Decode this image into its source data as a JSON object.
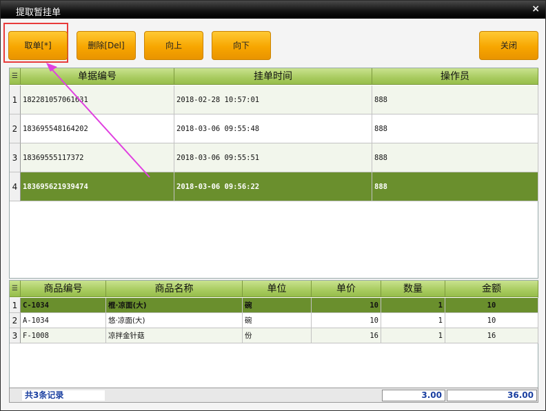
{
  "window": {
    "title": "提取暂挂单",
    "close_glyph": "×"
  },
  "toolbar": {
    "take_label": "取单[*]",
    "delete_label": "删除[Del]",
    "up_label": "向上",
    "down_label": "向下",
    "close_label": "关闭"
  },
  "orders": {
    "columns": [
      "单据编号",
      "挂单时间",
      "操作员"
    ],
    "rows": [
      {
        "idx": "1",
        "id": "182281057061631",
        "time": "2018-02-28 10:57:01",
        "operator": "888"
      },
      {
        "idx": "2",
        "id": "183695548164202",
        "time": "2018-03-06 09:55:48",
        "operator": "888"
      },
      {
        "idx": "3",
        "id": "18369555117372",
        "time": "2018-03-06 09:55:51",
        "operator": "888"
      },
      {
        "idx": "4",
        "id": "183695621939474",
        "time": "2018-03-06 09:56:22",
        "operator": "888"
      }
    ],
    "selected_row": 4
  },
  "items": {
    "columns": [
      "商品编号",
      "商品名称",
      "单位",
      "单价",
      "数量",
      "金额"
    ],
    "rows": [
      {
        "idx": "1",
        "code": "C-1034",
        "name": "棍·凉面(大)",
        "unit": "碗",
        "price": "10",
        "qty": "1",
        "amount": "10"
      },
      {
        "idx": "2",
        "code": "A-1034",
        "name": "悠·凉面(大)",
        "unit": "碗",
        "price": "10",
        "qty": "1",
        "amount": "10"
      },
      {
        "idx": "3",
        "code": "F-1008",
        "name": "凉拌金针菇",
        "unit": "份",
        "price": "16",
        "qty": "1",
        "amount": "16"
      }
    ],
    "selected_row": 1
  },
  "footer": {
    "record_count": "共3条记录",
    "total_qty": "3.00",
    "total_amount": "36.00"
  },
  "colors": {
    "accent_orange": "#f7a600",
    "header_green": "#a8cb5f",
    "selected_green": "#6a8f2d",
    "highlight_red": "#e83a3a",
    "arrow_magenta": "#e040e0"
  }
}
